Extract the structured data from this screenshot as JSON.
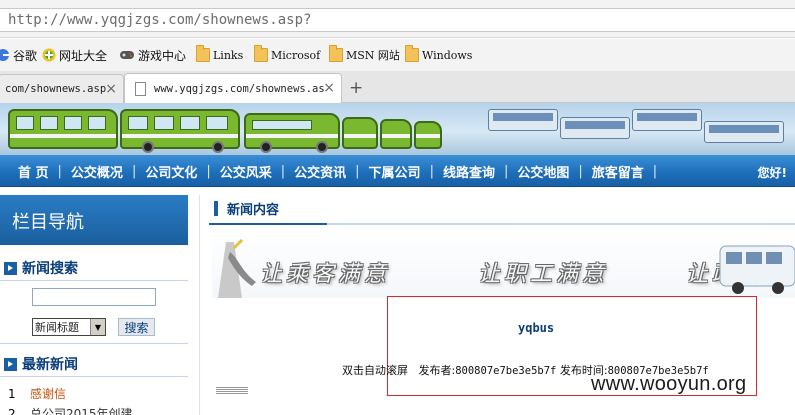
{
  "browser": {
    "url": "http://www.yqgjzgs.com/shownews.asp?",
    "bookmarks": [
      {
        "label": "谷歌",
        "icon": "google-icon"
      },
      {
        "label": "网址大全",
        "icon": "site-directory-icon"
      },
      {
        "label": "游戏中心",
        "icon": "gamepad-icon"
      },
      {
        "label": "Links",
        "icon": "folder-icon"
      },
      {
        "label": "Microsof",
        "icon": "folder-icon"
      },
      {
        "label": "MSN 网站",
        "icon": "folder-icon"
      },
      {
        "label": "Windows",
        "icon": "folder-icon"
      }
    ],
    "tabs": [
      {
        "title": "com/shownews.asp",
        "close": "×"
      },
      {
        "title": "www.yqgjzgs.com/shownews.asp",
        "close": "×"
      }
    ],
    "new_tab": "+"
  },
  "site": {
    "nav": [
      "首 页",
      "公交概况",
      "公司文化",
      "公交风采",
      "公交资讯",
      "下属公司",
      "线路查询",
      "公交地图",
      "旅客留言"
    ],
    "nav_separator": "|",
    "greeting": "您好!"
  },
  "sidebar": {
    "header": "栏目导航",
    "search_title": "新闻搜索",
    "search_input_value": "",
    "select_value": "新闻标题",
    "search_button": "搜索",
    "latest_title": "最新新闻",
    "latest_items": [
      {
        "num": "1",
        "title": "感谢信"
      },
      {
        "num": "2",
        "title": "总公司2015年创建"
      }
    ]
  },
  "main": {
    "section_title": "新闻内容",
    "slogans": [
      "让乘客满意",
      "让职工满意",
      "让政府满"
    ],
    "article_title": "yqbus",
    "meta": {
      "scroll_label": "双击自动滚屏",
      "publisher_label": "发布者:",
      "publisher_value": "800807e7be3e5b7f",
      "time_label": "发布时间:",
      "time_value": "800807e7be3e5b7f"
    }
  },
  "watermark": "www.wooyun.org",
  "colors": {
    "nav_blue": "#1d6db8",
    "highlight_red": "#d02c2c",
    "news_link": "#c2540e",
    "title_blue": "#0b3e78"
  }
}
